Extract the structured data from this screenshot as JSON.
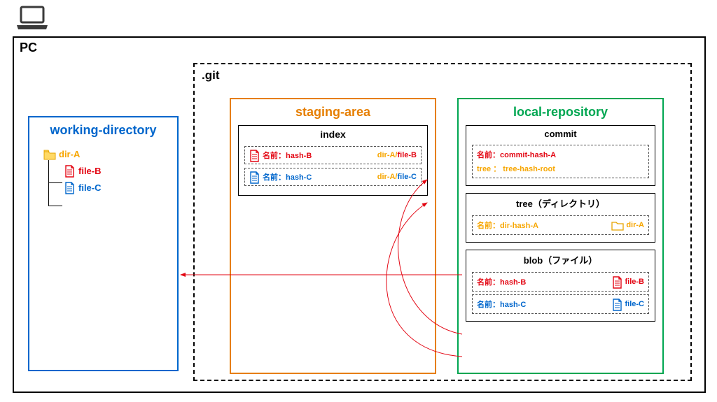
{
  "pc_label": "PC",
  "git_label": ".git",
  "working_directory": {
    "title": "working-directory",
    "dir_name": "dir-A",
    "file_b": "file-B",
    "file_c": "file-C"
  },
  "staging_area": {
    "title": "staging-area",
    "index_title": "index",
    "entries": [
      {
        "name_prefix": "名前：",
        "hash": "hash-B",
        "path_dir": "dir-A/",
        "path_file": "file-B"
      },
      {
        "name_prefix": "名前：",
        "hash": "hash-C",
        "path_dir": "dir-A/",
        "path_file": "file-C"
      }
    ]
  },
  "local_repository": {
    "title": "local-repository",
    "commit": {
      "title": "commit",
      "name_line": "名前：commit-hash-A",
      "tree_line": "tree ： tree-hash-root"
    },
    "tree": {
      "title": "tree（ディレクトリ）",
      "name_line": "名前：dir-hash-A",
      "dir_label": "dir-A"
    },
    "blob": {
      "title": "blob（ファイル）",
      "entries": [
        {
          "name_prefix": "名前：",
          "hash": "hash-B",
          "file": "file-B"
        },
        {
          "name_prefix": "名前：",
          "hash": "hash-C",
          "file": "file-C"
        }
      ]
    }
  }
}
